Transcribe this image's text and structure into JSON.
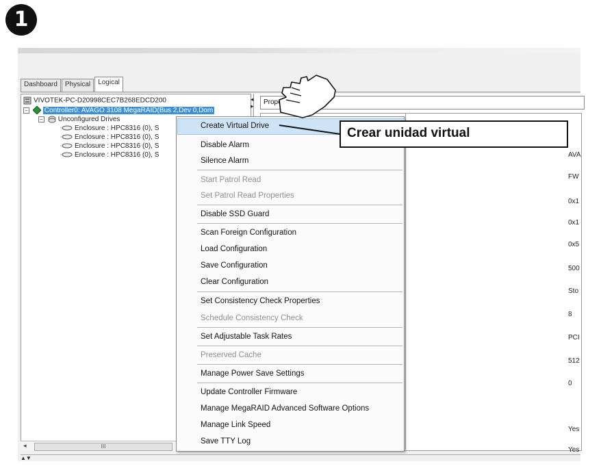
{
  "step_number": "1",
  "tabs": [
    {
      "label": "Dashboard",
      "active": false
    },
    {
      "label": "Physical",
      "active": false
    },
    {
      "label": "Logical",
      "active": true
    }
  ],
  "tree": {
    "host": "VIVOTEK-PC-D20998CEC7B268EDCD200",
    "controller": "Controller0: AVAGO 3108 MegaRAID(Bus 2,Dev 0,Dom",
    "group": "Unconfigured Drives",
    "enclosures": [
      "Enclosure : HPC8316 (0), S",
      "Enclosure : HPC8316 (0), S",
      "Enclosure : HPC8316 (0), S",
      "Enclosure : HPC8316 (0), S"
    ]
  },
  "scrollbar_thumb_label": "III",
  "properties_tab_label": "Prope",
  "property_values": [
    "AVA",
    "FW",
    "0x1",
    "0x1",
    "0x5",
    "500",
    "Sto",
    "8",
    "PCI",
    "512",
    "0",
    "Yes",
    "Yes"
  ],
  "context_menu": {
    "groups": [
      [
        {
          "label": "Create Virtual Drive",
          "disabled": false,
          "highlighted": true
        },
        {
          "label": "Disable Alarm",
          "disabled": false
        },
        {
          "label": "Silence Alarm",
          "disabled": false
        }
      ],
      [
        {
          "label": "Start Patrol Read",
          "disabled": true
        },
        {
          "label": "Set Patrol Read Properties",
          "disabled": true
        }
      ],
      [
        {
          "label": "Disable SSD Guard",
          "disabled": false
        }
      ],
      [
        {
          "label": "Scan Foreign Configuration",
          "disabled": false
        },
        {
          "label": "Load Configuration",
          "disabled": false
        },
        {
          "label": "Save Configuration",
          "disabled": false
        },
        {
          "label": "Clear Configuration",
          "disabled": false
        }
      ],
      [
        {
          "label": "Set Consistency Check Properties",
          "disabled": false
        },
        {
          "label": "Schedule Consistency Check",
          "disabled": true
        }
      ],
      [
        {
          "label": "Set Adjustable Task Rates",
          "disabled": false
        }
      ],
      [
        {
          "label": "Preserved Cache",
          "disabled": true
        }
      ],
      [
        {
          "label": "Manage Power Save Settings",
          "disabled": false
        }
      ],
      [
        {
          "label": "Update Controller Firmware",
          "disabled": false
        },
        {
          "label": "Manage MegaRAID Advanced Software Options",
          "disabled": false
        },
        {
          "label": "Manage Link Speed",
          "disabled": false
        },
        {
          "label": "Save TTY Log",
          "disabled": false
        }
      ]
    ]
  },
  "callout_text": "Crear unidad virtual",
  "colors": {
    "selection": "#3a8fd8",
    "highlight": "#cfe3f7",
    "disabled_text": "#8f8f8f",
    "controller_icon": "#2e8b3a"
  }
}
